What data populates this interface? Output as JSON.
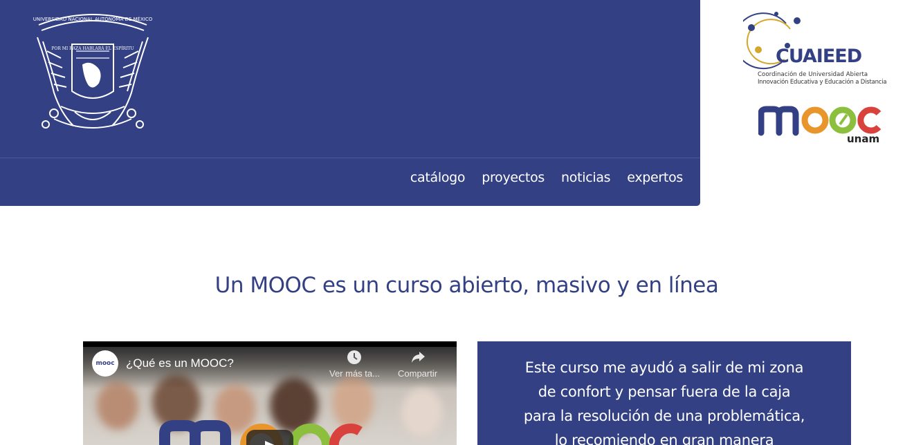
{
  "header": {
    "seal_text": "UNIVERSIDAD NACIONAL AUTÓNOMA DE MÉXICO",
    "seal_motto": "POR MI RAZA HABLARÁ EL ESPÍRITU",
    "nav": [
      "catálogo",
      "proyectos",
      "noticias",
      "expertos"
    ]
  },
  "logos": {
    "cuaieed": "CUAIEED",
    "cuaieed_line1": "Coordinación de Universidad Abierta",
    "cuaieed_line2": "Innovación Educativa y Educación a Distancia",
    "mooc_word": "mooc",
    "mooc_sub": "unam"
  },
  "main": {
    "title": "Un MOOC es un curso abierto, masivo y en línea"
  },
  "video": {
    "channel": "mooc",
    "title": "¿Qué es un MOOC?",
    "watch_later": "Ver más ta...",
    "share": "Compartir"
  },
  "testimonial": {
    "lines": [
      "Este curso me ayudó a salir de mi zona",
      "de confort y pensar fuera de la caja",
      "para la resolución de una problemática,",
      "lo recomiendo en gran manera"
    ]
  },
  "colors": {
    "brand_blue": "#334084",
    "mooc_orange": "#e8962b",
    "mooc_green": "#8dbf3f",
    "mooc_red": "#d9413d",
    "cuaieed_gold": "#d4a72c"
  }
}
